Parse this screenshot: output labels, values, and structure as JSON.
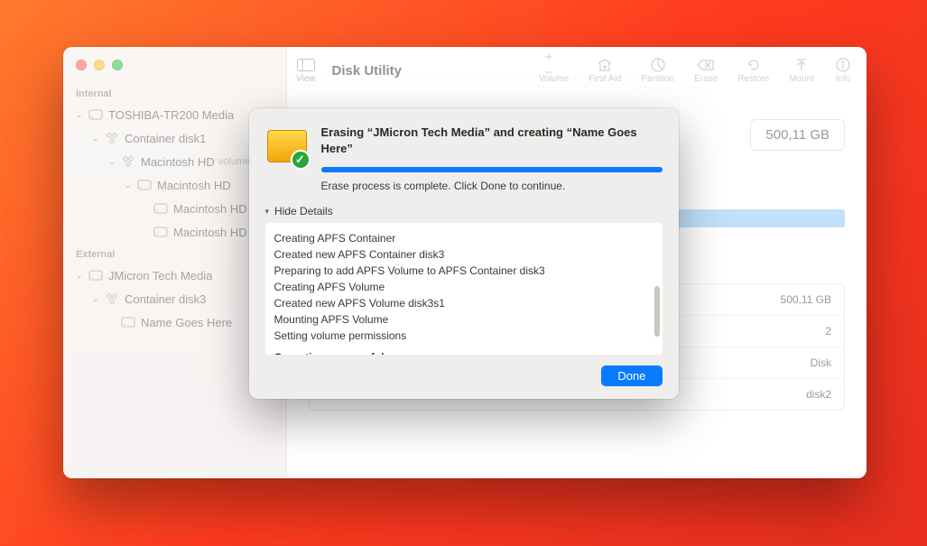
{
  "window": {
    "app_title": "Disk Utility",
    "toolbar": {
      "view_label": "View",
      "actions": [
        {
          "id": "volume",
          "label": "Volume"
        },
        {
          "id": "firstaid",
          "label": "First Aid"
        },
        {
          "id": "partition",
          "label": "Partition"
        },
        {
          "id": "erase",
          "label": "Erase"
        },
        {
          "id": "restore",
          "label": "Restore"
        },
        {
          "id": "mount",
          "label": "Mount"
        },
        {
          "id": "info",
          "label": "Info"
        }
      ]
    },
    "capacity_badge": "500,11 GB"
  },
  "sidebar": {
    "sections": [
      {
        "label": "Internal",
        "items": [
          {
            "level": 0,
            "chev": true,
            "icon": "hdd",
            "text": "TOSHIBA-TR200 Media"
          },
          {
            "level": 1,
            "chev": true,
            "icon": "cluster",
            "text": "Container disk1"
          },
          {
            "level": 2,
            "chev": true,
            "icon": "cluster",
            "text": "Macintosh HD",
            "sub": "volumes"
          },
          {
            "level": 3,
            "chev": true,
            "icon": "hdd",
            "text": "Macintosh HD"
          },
          {
            "level": 4,
            "chev": false,
            "icon": "hdd",
            "text": "Macintosh HD"
          },
          {
            "level": 4,
            "chev": false,
            "icon": "hdd",
            "text": "Macintosh HD - D"
          }
        ]
      },
      {
        "label": "External",
        "items": [
          {
            "level": 0,
            "chev": true,
            "icon": "hdd",
            "text": "JMicron Tech Media"
          },
          {
            "level": 1,
            "chev": true,
            "icon": "cluster",
            "text": "Container disk3"
          },
          {
            "level": 2,
            "chev": false,
            "icon": "hdd",
            "text": "Name Goes Here"
          }
        ]
      }
    ]
  },
  "info_rows": [
    "500,11 GB",
    "2",
    "Disk",
    "disk2"
  ],
  "modal": {
    "title": "Erasing “JMicron Tech Media” and creating “Name Goes Here”",
    "status": "Erase process is complete. Click Done to continue.",
    "details_toggle": "Hide Details",
    "log": [
      "Creating APFS Container",
      "Created new APFS Container disk3",
      "Preparing to add APFS Volume to APFS Container disk3",
      "Creating APFS Volume",
      "Created new APFS Volume disk3s1",
      "Mounting APFS Volume",
      "Setting volume permissions"
    ],
    "log_final": "Operation successful.",
    "done_label": "Done"
  }
}
